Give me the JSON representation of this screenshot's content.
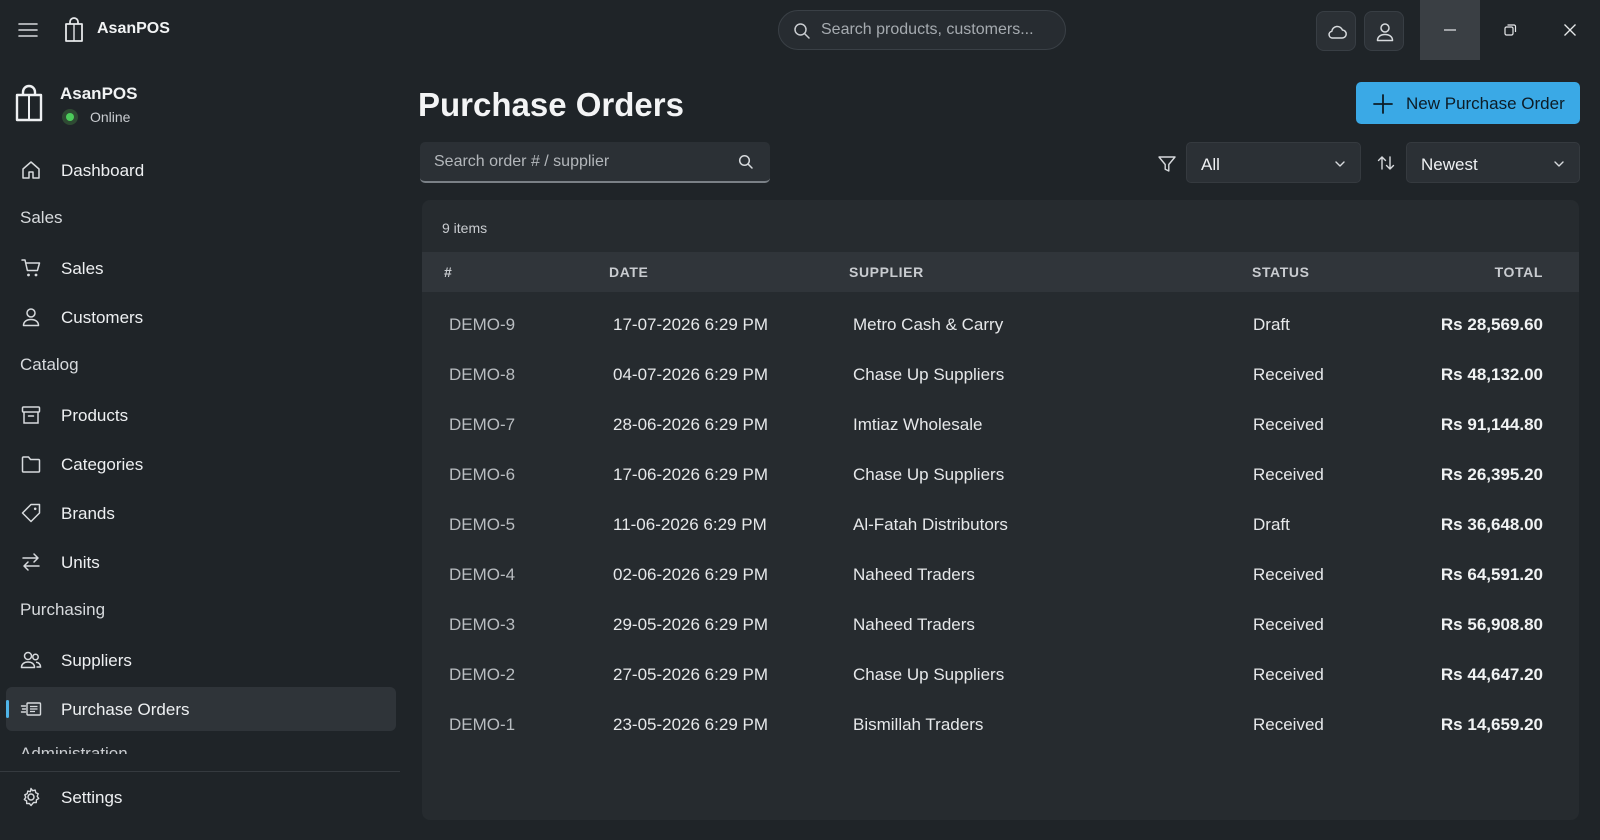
{
  "app": {
    "name": "AsanPOS",
    "search_placeholder": "Search products, customers..."
  },
  "sidebar": {
    "brand": "AsanPOS",
    "status": "Online",
    "status_color": "#4ccb5b",
    "dashboard": "Dashboard",
    "section_sales": "Sales",
    "sales": "Sales",
    "customers": "Customers",
    "section_catalog": "Catalog",
    "products": "Products",
    "categories": "Categories",
    "brands": "Brands",
    "units": "Units",
    "section_purchasing": "Purchasing",
    "suppliers": "Suppliers",
    "purchase_orders": "Purchase Orders",
    "section_admin": "Administration",
    "settings": "Settings"
  },
  "page": {
    "title": "Purchase Orders",
    "new_button": "New Purchase Order",
    "accent_color": "#3aa9e6",
    "search_placeholder": "Search order # / supplier",
    "filter_value": "All",
    "sort_value": "Newest",
    "items_count": "9 items"
  },
  "table": {
    "columns": [
      "#",
      "DATE",
      "SUPPLIER",
      "STATUS",
      "TOTAL"
    ],
    "rows": [
      {
        "id": "DEMO-9",
        "date": "17-07-2026 6:29 PM",
        "supplier": "Metro Cash & Carry",
        "status": "Draft",
        "total": "Rs 28,569.60"
      },
      {
        "id": "DEMO-8",
        "date": "04-07-2026 6:29 PM",
        "supplier": "Chase Up Suppliers",
        "status": "Received",
        "total": "Rs 48,132.00"
      },
      {
        "id": "DEMO-7",
        "date": "28-06-2026 6:29 PM",
        "supplier": "Imtiaz Wholesale",
        "status": "Received",
        "total": "Rs 91,144.80"
      },
      {
        "id": "DEMO-6",
        "date": "17-06-2026 6:29 PM",
        "supplier": "Chase Up Suppliers",
        "status": "Received",
        "total": "Rs 26,395.20"
      },
      {
        "id": "DEMO-5",
        "date": "11-06-2026 6:29 PM",
        "supplier": "Al-Fatah Distributors",
        "status": "Draft",
        "total": "Rs 36,648.00"
      },
      {
        "id": "DEMO-4",
        "date": "02-06-2026 6:29 PM",
        "supplier": "Naheed Traders",
        "status": "Received",
        "total": "Rs 64,591.20"
      },
      {
        "id": "DEMO-3",
        "date": "29-05-2026 6:29 PM",
        "supplier": "Naheed Traders",
        "status": "Received",
        "total": "Rs 56,908.80"
      },
      {
        "id": "DEMO-2",
        "date": "27-05-2026 6:29 PM",
        "supplier": "Chase Up Suppliers",
        "status": "Received",
        "total": "Rs 44,647.20"
      },
      {
        "id": "DEMO-1",
        "date": "23-05-2026 6:29 PM",
        "supplier": "Bismillah Traders",
        "status": "Received",
        "total": "Rs 14,659.20"
      }
    ]
  }
}
